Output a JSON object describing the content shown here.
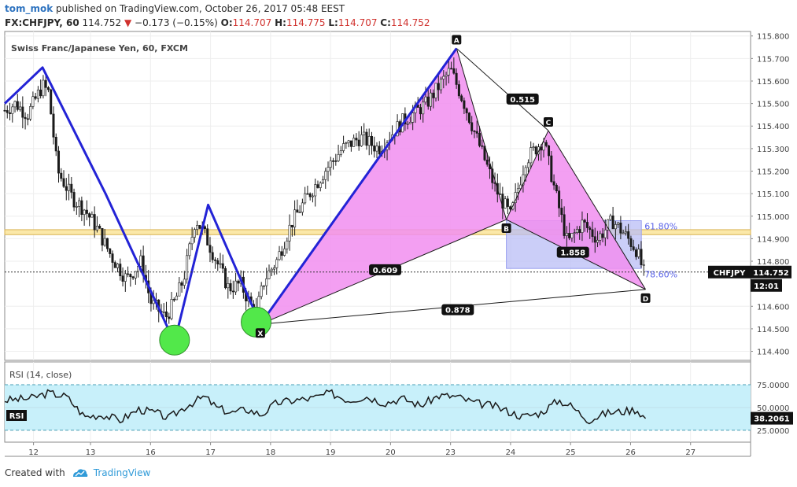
{
  "header": {
    "user": "tom_mok",
    "published": "published on TradingView.com, October 26, 2017 05:48 EEST",
    "symbol_tf": "FX:CHFJPY, 60",
    "last": "114.752",
    "change_arrow": "▼",
    "change": "−0.173 (−0.15%)",
    "o_label": "O:",
    "o": "114.707",
    "h_label": "H:",
    "h": "114.775",
    "l_label": "L:",
    "l": "114.707",
    "c_label": "C:",
    "c": "114.752"
  },
  "footer": {
    "created_with": "Created with",
    "brand": "TradingView"
  },
  "colors": {
    "pattern_fill": "#f18ef0",
    "pattern_line": "#1a1a1a",
    "zigzag": "#2323d6",
    "green_circle": "#52e84a",
    "zone_fill": "#fbe8a8",
    "fib_box": "#b9bdf5",
    "rsi_fill": "#c8f0fa",
    "candle": "#1a1a1a"
  },
  "chart_data": [
    {
      "type": "candlestick",
      "title": "Swiss Franc/Japanese Yen, 60, FXCM",
      "ylim": [
        114.36,
        115.82
      ],
      "y_ticks": [
        "115.800",
        "115.700",
        "115.600",
        "115.500",
        "115.400",
        "115.300",
        "115.200",
        "115.100",
        "115.000",
        "114.900",
        "114.800",
        "114.600",
        "114.500",
        "114.400"
      ],
      "y_tick_values": [
        115.8,
        115.7,
        115.6,
        115.5,
        115.4,
        115.3,
        115.2,
        115.1,
        115.0,
        114.9,
        114.8,
        114.6,
        114.5,
        114.4
      ],
      "x_ticks": [
        "12",
        "13",
        "16",
        "17",
        "18",
        "19",
        "20",
        "23",
        "24",
        "25",
        "26",
        "27"
      ],
      "x_tick_pos": [
        0.05,
        1.0,
        2.0,
        3.0,
        4.0,
        5.0,
        6.0,
        7.0,
        8.0,
        9.0,
        10.0,
        11.0
      ],
      "x_range": [
        -0.43,
        12.0
      ],
      "price_path": [
        [
          -0.43,
          115.47
        ],
        [
          -0.25,
          115.5
        ],
        [
          -0.05,
          115.45
        ],
        [
          0.2,
          115.58
        ],
        [
          0.3,
          115.55
        ],
        [
          0.45,
          115.2
        ],
        [
          0.7,
          115.08
        ],
        [
          0.9,
          115.03
        ],
        [
          1.1,
          114.95
        ],
        [
          1.35,
          114.82
        ],
        [
          1.6,
          114.72
        ],
        [
          1.85,
          114.8
        ],
        [
          2.0,
          114.62
        ],
        [
          2.25,
          114.55
        ],
        [
          2.4,
          114.62
        ],
        [
          2.55,
          114.72
        ],
        [
          2.75,
          114.99
        ],
        [
          2.9,
          114.92
        ],
        [
          3.1,
          114.8
        ],
        [
          3.3,
          114.68
        ],
        [
          3.5,
          114.7
        ],
        [
          3.75,
          114.56
        ],
        [
          3.9,
          114.72
        ],
        [
          4.1,
          114.8
        ],
        [
          4.35,
          114.97
        ],
        [
          4.6,
          115.08
        ],
        [
          4.9,
          115.2
        ],
        [
          5.2,
          115.3
        ],
        [
          5.5,
          115.35
        ],
        [
          5.8,
          115.3
        ],
        [
          6.2,
          115.42
        ],
        [
          6.6,
          115.5
        ],
        [
          7.0,
          115.65
        ],
        [
          7.2,
          115.52
        ],
        [
          7.5,
          115.3
        ],
        [
          7.75,
          115.12
        ],
        [
          8.0,
          115.0
        ],
        [
          8.25,
          115.25
        ],
        [
          8.55,
          115.34
        ],
        [
          8.75,
          115.1
        ],
        [
          8.95,
          114.88
        ],
        [
          9.2,
          114.97
        ],
        [
          9.45,
          114.9
        ],
        [
          9.7,
          114.98
        ],
        [
          9.9,
          114.92
        ],
        [
          10.1,
          114.85
        ],
        [
          10.22,
          114.75
        ]
      ],
      "harmonic_points": [
        {
          "label": "X",
          "x": 3.83,
          "y": 114.52
        },
        {
          "label": "A",
          "x": 7.1,
          "y": 115.745
        },
        {
          "label": "B",
          "x": 7.93,
          "y": 114.985
        },
        {
          "label": "C",
          "x": 8.63,
          "y": 115.38
        },
        {
          "label": "D",
          "x": 10.25,
          "y": 114.675
        }
      ],
      "ratios": [
        {
          "text": "0.515",
          "x": 8.2,
          "y": 115.52
        },
        {
          "text": "0.609",
          "x": 5.91,
          "y": 114.762
        },
        {
          "text": "1.858",
          "x": 9.04,
          "y": 114.84
        },
        {
          "text": "0.878",
          "x": 7.12,
          "y": 114.585
        }
      ],
      "zigzag": [
        [
          -0.43,
          115.5
        ],
        [
          0.2,
          115.66
        ],
        [
          1.25,
          115.1
        ],
        [
          2.4,
          114.44
        ],
        [
          2.96,
          115.05
        ],
        [
          3.83,
          114.52
        ],
        [
          7.1,
          115.745
        ]
      ],
      "green_circles": [
        [
          2.4,
          114.45
        ],
        [
          3.76,
          114.53
        ]
      ],
      "zone": {
        "y1": 114.918,
        "y2": 114.94
      },
      "fib_box": {
        "x1": 7.93,
        "x2": 10.18,
        "y1": 114.768,
        "y2": 114.98
      },
      "fib_levels": [
        {
          "text": "61.80%",
          "y": 114.955
        },
        {
          "text": "78.60%",
          "y": 114.742
        }
      ],
      "current": {
        "symbol": "CHFJPY",
        "price": "114.752",
        "value": 114.752,
        "countdown": "12:01"
      }
    },
    {
      "type": "line",
      "title": "RSI (14, close)",
      "legend": "RSI",
      "ylim": [
        12,
        100
      ],
      "y_ticks": [
        "75.0000",
        "50.0000",
        "25.0000"
      ],
      "y_tick_values": [
        75,
        50,
        25
      ],
      "band": [
        25,
        75
      ],
      "current": {
        "value": 38.2061,
        "label": "38.2061"
      },
      "x": [
        -0.43,
        0.0,
        0.3,
        0.6,
        0.9,
        1.2,
        1.5,
        1.8,
        2.1,
        2.3,
        2.6,
        2.9,
        3.1,
        3.35,
        3.6,
        3.85,
        4.1,
        4.4,
        4.7,
        5.0,
        5.3,
        5.6,
        5.9,
        6.2,
        6.5,
        6.8,
        7.1,
        7.4,
        7.7,
        7.95,
        8.2,
        8.5,
        8.8,
        9.0,
        9.3,
        9.6,
        9.9,
        10.1,
        10.25
      ],
      "values": [
        58,
        60,
        66,
        62,
        40,
        42,
        36,
        48,
        44,
        38,
        52,
        62,
        50,
        44,
        48,
        42,
        55,
        58,
        60,
        66,
        58,
        62,
        55,
        60,
        52,
        63,
        62,
        55,
        52,
        46,
        40,
        44,
        58,
        52,
        36,
        44,
        46,
        48,
        38
      ]
    }
  ]
}
